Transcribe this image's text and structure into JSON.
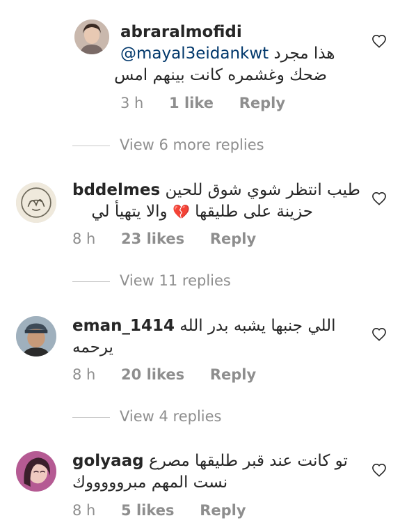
{
  "colors": {
    "text": "#262626",
    "secondary": "#8e8e8e",
    "mention": "#00376b",
    "broken_heart": "#d4334d"
  },
  "comments": [
    {
      "username": "abraralmofidi",
      "text_line1": "هذا مجرد",
      "mention": "@mayal3eidankwt",
      "text_line2": "ضحك وغشمره كانت بينهم امس",
      "time": "3 h",
      "likes": "1 like",
      "reply": "Reply",
      "view_replies": "View 6 more replies",
      "avatar_icon": "profile-photo-woman",
      "like_icon": "heart-outline-icon"
    },
    {
      "username": "bddelmes",
      "text_line1": "طيب انتظر شوي شوق للحين",
      "text_line2a": "حزينة على طليقها",
      "emoji": "💔",
      "text_line2b": "والا يتهيأ لي",
      "time": "8 h",
      "likes": "23 likes",
      "reply": "Reply",
      "view_replies": "View 11 replies",
      "avatar_icon": "calligraphy-seal",
      "like_icon": "heart-outline-icon"
    },
    {
      "username": "eman_1414",
      "text_line1": "اللي جنبها يشبه بدر الله",
      "text_line2": "يرحمه",
      "time": "8 h",
      "likes": "20 likes",
      "reply": "Reply",
      "view_replies": "View 4 replies",
      "avatar_icon": "profile-photo-man",
      "like_icon": "heart-outline-icon"
    },
    {
      "username": "golyaag",
      "text_line1": "تو كانت عند قبر طليقها مصرع",
      "text_line2": "نست المهم مبروووووك",
      "time": "8 h",
      "likes": "5 likes",
      "reply": "Reply",
      "avatar_icon": "profile-photo-woman-pink",
      "like_icon": "heart-outline-icon"
    }
  ]
}
